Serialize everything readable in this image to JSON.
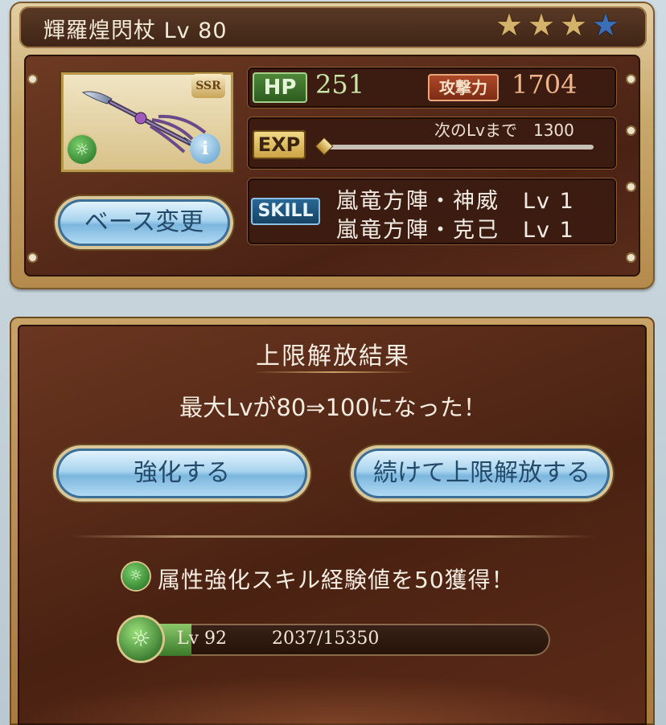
{
  "weapon": {
    "title": "輝羅煌閃杖 Lv 80",
    "rarity": "SSR",
    "stars": [
      {
        "state": "filled",
        "glyph": "★"
      },
      {
        "state": "filled",
        "glyph": "★"
      },
      {
        "state": "filled",
        "glyph": "★"
      },
      {
        "state": "empty",
        "glyph": "★"
      }
    ],
    "element_icon": "wind-element-icon",
    "info_glyph": "i"
  },
  "stats": {
    "hp_label": "HP",
    "hp_value": "251",
    "atk_label": "攻撃力",
    "atk_value": "1704",
    "exp_label": "EXP",
    "exp_next": "次のLvまで　1300",
    "exp_progress_fraction": 0.0,
    "skill_label": "SKILL",
    "skills": [
      "嵐竜方陣・神威　Lv 1",
      "嵐竜方陣・克己　Lv 1"
    ]
  },
  "buttons": {
    "base_change": "ベース変更",
    "enhance": "強化する",
    "continue_uncap": "続けて上限解放する"
  },
  "result": {
    "title": "上限解放結果",
    "message": "最大Lvが80⇒100になった！",
    "gain_text": "属性強化スキル経験値を50獲得！",
    "skill_level": "Lv 92",
    "skill_progress": "2037/15350",
    "skill_progress_fraction": 0.133
  },
  "colors": {
    "hp_value": "#c8e6a6",
    "atk_value": "#f0b48a",
    "button_text": "#244a6a",
    "panel_brown": "#4a2214"
  }
}
